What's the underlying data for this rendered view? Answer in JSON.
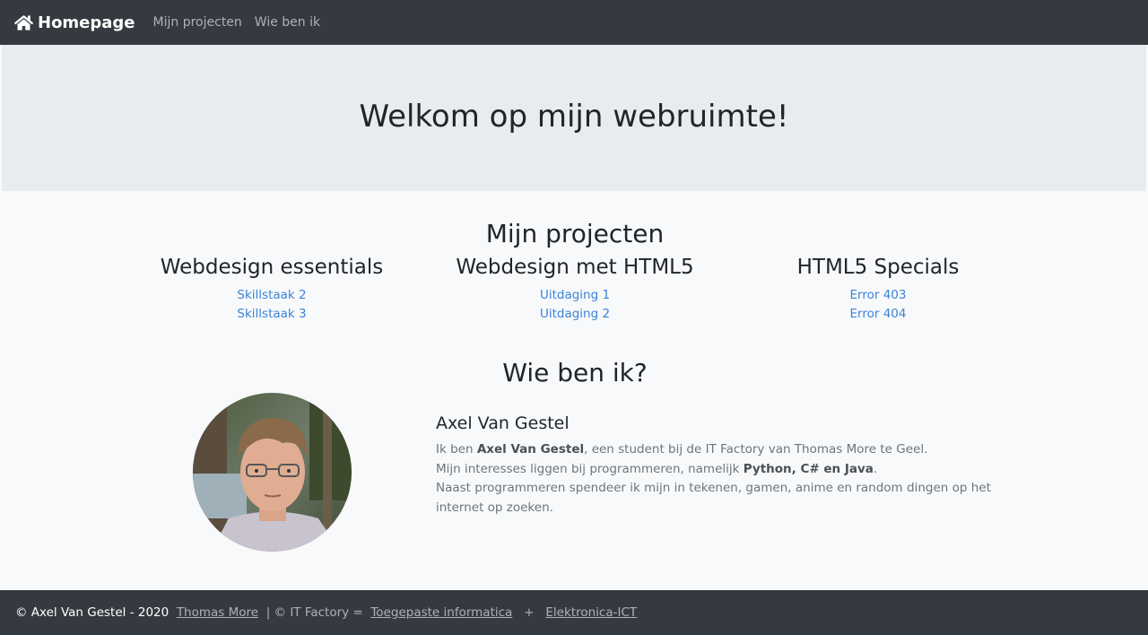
{
  "navbar": {
    "brand": "Homepage",
    "links": [
      "Mijn projecten",
      "Wie ben ik"
    ]
  },
  "jumbotron": {
    "title": "Welkom op mijn webruimte!"
  },
  "projects": {
    "title": "Mijn projecten",
    "columns": [
      {
        "title": "Webdesign essentials",
        "links": [
          "Skillstaak 2",
          "Skillstaak 3"
        ]
      },
      {
        "title": "Webdesign met HTML5",
        "links": [
          "Uitdaging 1",
          "Uitdaging 2"
        ]
      },
      {
        "title": "HTML5 Specials",
        "links": [
          "Error 403",
          "Error 404"
        ]
      }
    ]
  },
  "about": {
    "title": "Wie ben ik?",
    "name": "Axel Van Gestel",
    "line1_pre": "Ik ben ",
    "line1_bold": "Axel Van Gestel",
    "line1_post": ", een student bij de IT Factory van Thomas More te Geel.",
    "line2_pre": "Mijn interesses liggen bij programmeren, namelijk ",
    "line2_bold": "Python, C# en Java",
    "line2_post": ".",
    "line3": "Naast programmeren spendeer ik mijn in tekenen, gamen, anime en random dingen op het internet op zoeken."
  },
  "footer": {
    "copyright": "© Axel Van Gestel - 2020",
    "link1": "Thomas More",
    "mid": "| © IT Factory =",
    "link2": "Toegepaste informatica",
    "plus": "+",
    "link3": "Elektronica-ICT"
  },
  "colors": {
    "navbar": "#343a40",
    "jumbotron": "#e9ecef",
    "link": "#3b83d9"
  }
}
